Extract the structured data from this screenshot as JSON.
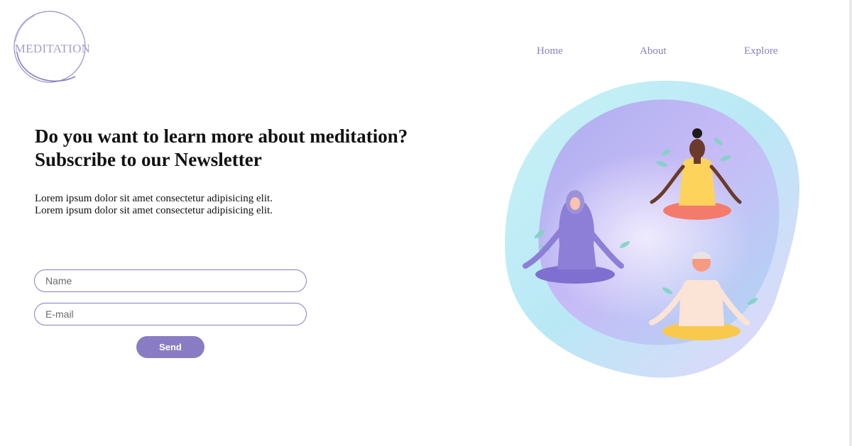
{
  "logo": {
    "text": "MEDITATION"
  },
  "nav": {
    "items": [
      {
        "label": "Home"
      },
      {
        "label": "About"
      },
      {
        "label": "Explore"
      }
    ]
  },
  "hero": {
    "headline_line1": "Do you want to learn more about meditation?",
    "headline_line2": "Subscribe to our Newsletter",
    "body_line1": "Lorem ipsum dolor sit amet consectetur adipisicing elit.",
    "body_line2": "Lorem ipsum dolor sit amet consectetur adipisicing elit."
  },
  "form": {
    "name_placeholder": "Name",
    "email_placeholder": "E-mail",
    "send_label": "Send"
  },
  "colors": {
    "accent": "#8a7cc4",
    "text": "#111111",
    "background": "#ffffff"
  }
}
